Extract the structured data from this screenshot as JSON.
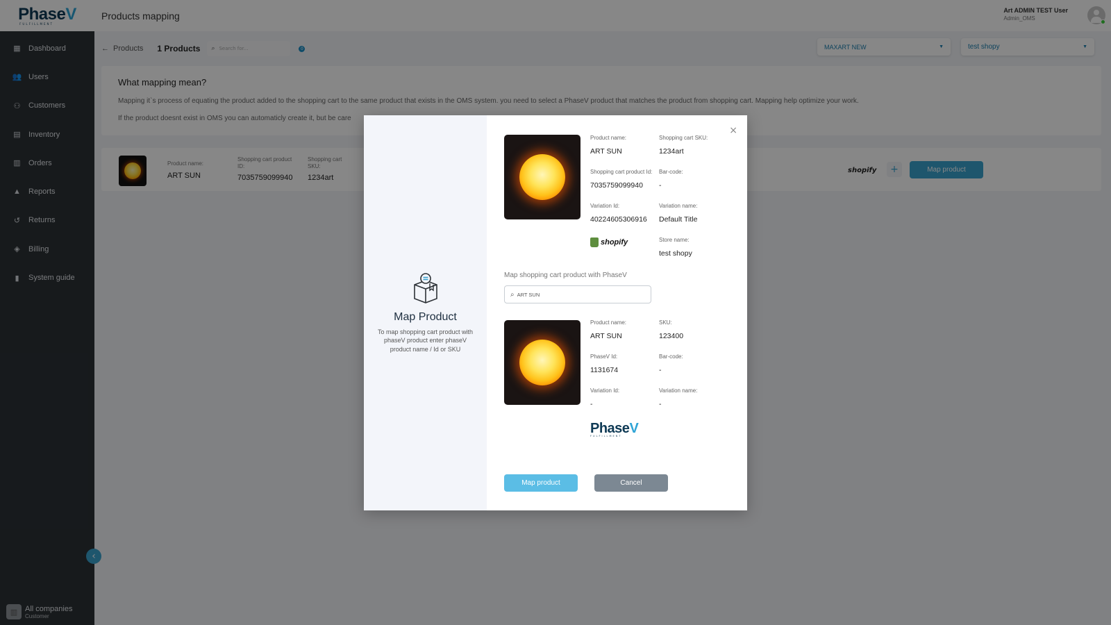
{
  "header": {
    "logo_text": "Phase",
    "logo_v": "V",
    "logo_sub": "FULFILLMENT",
    "title": "Products mapping",
    "user_name": "Art ADMIN TEST User",
    "user_role": "Admin_OMS"
  },
  "sidebar": {
    "items": [
      {
        "label": "Dashboard",
        "icon": "dashboard-icon",
        "glyph": "▦"
      },
      {
        "label": "Users",
        "icon": "users-icon",
        "glyph": "👥"
      },
      {
        "label": "Customers",
        "icon": "customers-icon",
        "glyph": "⚇"
      },
      {
        "label": "Inventory",
        "icon": "inventory-icon",
        "glyph": "▤"
      },
      {
        "label": "Orders",
        "icon": "orders-icon",
        "glyph": "▥"
      },
      {
        "label": "Reports",
        "icon": "reports-icon",
        "glyph": "▲"
      },
      {
        "label": "Returns",
        "icon": "returns-icon",
        "glyph": "↺"
      },
      {
        "label": "Billing",
        "icon": "billing-icon",
        "glyph": "◈"
      },
      {
        "label": "System guide",
        "icon": "system-guide-icon",
        "glyph": "▮"
      }
    ],
    "collapse_glyph": "‹",
    "company_name": "All companies",
    "company_type": "Customer"
  },
  "toolbar": {
    "back_label": "Products",
    "count_label": "1 Products",
    "search_placeholder": "Search for...",
    "info_glyph": "0",
    "select_company": "MAXART NEW",
    "select_store": "test shopy"
  },
  "info": {
    "title": "What mapping mean?",
    "paragraph1": "Mapping it`s process of equating the product added to the shopping cart to the same product that exists in the OMS system. you need to select a PhaseV product that matches the product from shopping cart. Mapping help optimize your work.",
    "paragraph2": "If the product doesnt exist in OMS you can automaticly create it, but be care"
  },
  "product_row": {
    "name_label": "Product name:",
    "name": "ART SUN",
    "cart_id_label": "Shopping cart product ID:",
    "cart_id": "7035759099940",
    "sku_label": "Shopping cart SKU:",
    "sku": "1234art",
    "platform": "shopify",
    "add_glyph": "+",
    "map_button": "Map product"
  },
  "modal": {
    "title": "Map Product",
    "description": "To map shopping cart product with phaseV product enter phaseV product name / Id or SKU",
    "close_glyph": "×",
    "cart_product": {
      "name_label": "Product name:",
      "name": "ART SUN",
      "sku_label": "Shopping cart SKU:",
      "sku": "1234art",
      "cart_id_label": "Shopping cart product Id:",
      "cart_id": "7035759099940",
      "barcode_label": "Bar-code:",
      "barcode": "-",
      "variation_id_label": "Variation Id:",
      "variation_id": "40224605306916",
      "variation_name_label": "Variation name:",
      "variation_name": "Default Title",
      "platform": "shopify",
      "store_label": "Store name:",
      "store": "test shopy"
    },
    "search_label": "Map shopping cart product with PhaseV",
    "search_value": "ART SUN",
    "phasev_product": {
      "name_label": "Product name:",
      "name": "ART SUN",
      "sku_label": "SKU:",
      "sku": "123400",
      "id_label": "PhaseV Id:",
      "id": "1131674",
      "barcode_label": "Bar-code:",
      "barcode": "-",
      "variation_id_label": "Variation Id:",
      "variation_id": "-",
      "variation_name_label": "Variation name:",
      "variation_name": "-"
    },
    "map_button": "Map product",
    "cancel_button": "Cancel"
  },
  "colors": {
    "accent": "#3aa2cf",
    "primary_button": "#5bbde5",
    "secondary_button": "#7c8893",
    "sidebar": "#2c3136",
    "brand_dark": "#0f3a55"
  }
}
